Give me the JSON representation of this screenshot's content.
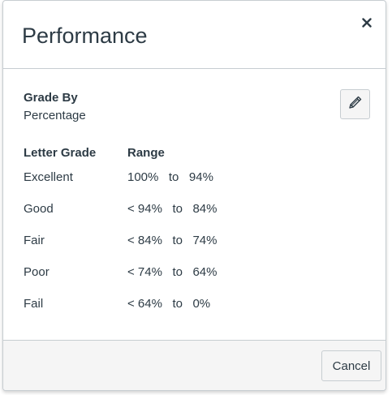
{
  "dialog": {
    "title": "Performance",
    "close_label": "×"
  },
  "grade_by": {
    "label": "Grade By",
    "value": "Percentage"
  },
  "table": {
    "headers": {
      "letter_grade": "Letter Grade",
      "range": "Range"
    },
    "rows": [
      {
        "name": "Excellent",
        "range": "100%   to   94%"
      },
      {
        "name": "Good",
        "range": "< 94%   to   84%"
      },
      {
        "name": "Fair",
        "range": "< 84%   to   74%"
      },
      {
        "name": "Poor",
        "range": "< 74%   to   64%"
      },
      {
        "name": "Fail",
        "range": "< 64%   to   0%"
      }
    ]
  },
  "footer": {
    "cancel_label": "Cancel"
  },
  "icons": {
    "close": "close-icon",
    "edit": "pencil-icon"
  },
  "colors": {
    "text": "#2d3b45",
    "border": "#c7cdd1",
    "footer_bg": "#f5f5f5"
  }
}
